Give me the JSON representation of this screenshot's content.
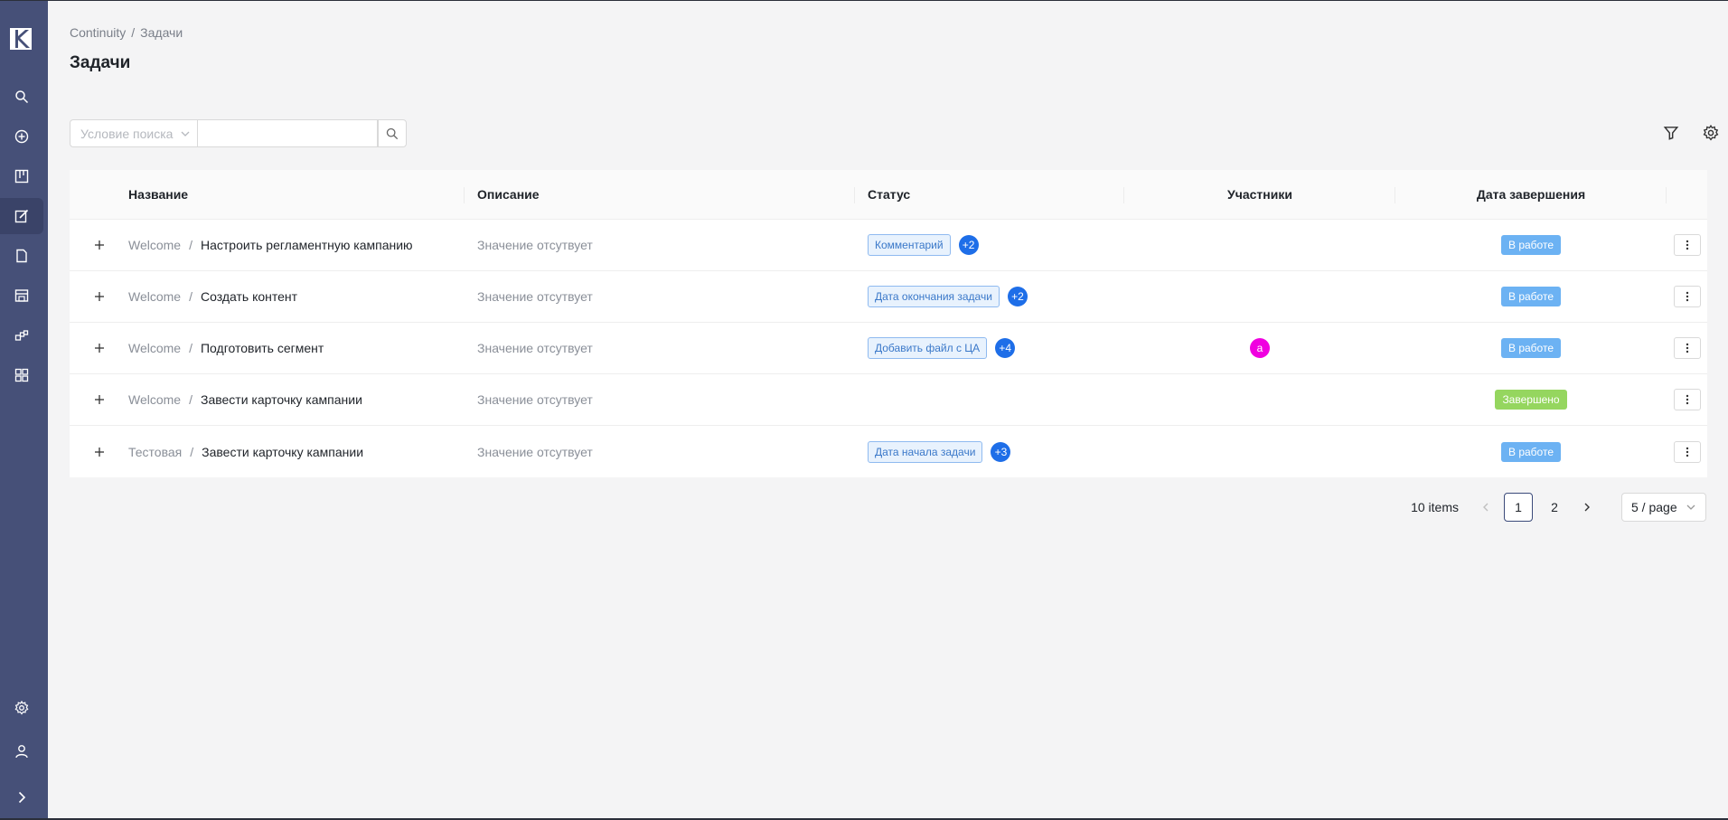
{
  "sidebar": {
    "items": [
      {
        "name": "search-icon"
      },
      {
        "name": "add-circle-icon"
      },
      {
        "name": "board-icon"
      },
      {
        "name": "edit-tasks-icon",
        "active": true
      },
      {
        "name": "file-icon"
      },
      {
        "name": "store-icon"
      },
      {
        "name": "blocks-icon"
      },
      {
        "name": "apps-icon"
      }
    ],
    "bottom": [
      {
        "name": "settings-icon"
      },
      {
        "name": "user-icon"
      },
      {
        "name": "expand-icon"
      }
    ]
  },
  "breadcrumb": {
    "root": "Continuity",
    "separator": "/",
    "current": "Задачи"
  },
  "page_title": "Задачи",
  "search": {
    "condition_placeholder": "Условие поиска",
    "value": ""
  },
  "table": {
    "columns": [
      "Название",
      "Описание",
      "Статус",
      "Участники",
      "Дата завершения"
    ],
    "rows": [
      {
        "prefix": "Welcome",
        "title": "Настроить регламентную кампанию",
        "description": "Значение отсутвует",
        "tag": "Комментарий",
        "tag_more": "+2",
        "avatar": "",
        "status": "В работе",
        "status_color": "#6cb2f3"
      },
      {
        "prefix": "Welcome",
        "title": "Создать контент",
        "description": "Значение отсутвует",
        "tag": "Дата окончания задачи",
        "tag_more": "+2",
        "avatar": "",
        "status": "В работе",
        "status_color": "#6cb2f3"
      },
      {
        "prefix": "Welcome",
        "title": "Подготовить сегмент",
        "description": "Значение отсутвует",
        "tag": "Добавить файл с ЦА",
        "tag_more": "+4",
        "avatar": "a",
        "status": "В работе",
        "status_color": "#6cb2f3"
      },
      {
        "prefix": "Welcome",
        "title": "Завести карточку кампании",
        "description": "Значение отсутвует",
        "tag": "",
        "tag_more": "",
        "avatar": "",
        "status": "Завершено",
        "status_color": "#95d65f"
      },
      {
        "prefix": "Тестовая",
        "title": "Завести карточку кампании",
        "description": "Значение отсутвует",
        "tag": "Дата начала задачи",
        "tag_more": "+3",
        "avatar": "",
        "status": "В работе",
        "status_color": "#6cb2f3"
      }
    ]
  },
  "pagination": {
    "total": "10 items",
    "pages": [
      "1",
      "2"
    ],
    "current": "1",
    "page_size": "5 / page"
  },
  "colors": {
    "sidebar": "#465078",
    "accent": "#1e6ee8",
    "in_progress": "#6cb2f3",
    "done": "#95d65f",
    "avatar": "#f000e0"
  }
}
